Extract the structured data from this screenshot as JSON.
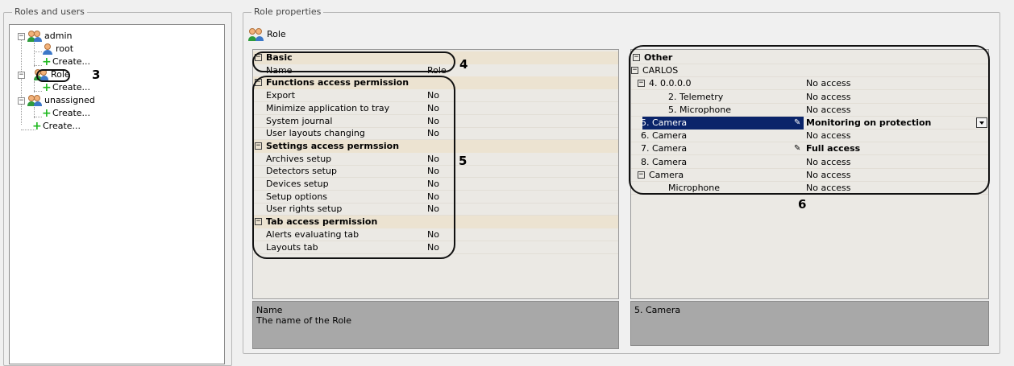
{
  "roles_panel": {
    "title": "Roles and users",
    "tree": [
      {
        "label": "admin"
      },
      {
        "label": "root"
      },
      {
        "label": "Create..."
      },
      {
        "label": "Role"
      },
      {
        "label": "Create..."
      },
      {
        "label": "unassigned"
      },
      {
        "label": "Create..."
      },
      {
        "label": "Create..."
      }
    ]
  },
  "props_panel": {
    "title": "Role properties",
    "header_label": "Role"
  },
  "left_grid": {
    "rows": [
      {
        "type": "cat",
        "name": "Basic"
      },
      {
        "type": "item",
        "name": "Name",
        "value": "Role"
      },
      {
        "type": "cat",
        "name": "Functions access permission"
      },
      {
        "type": "item",
        "name": "Export",
        "value": "No"
      },
      {
        "type": "item",
        "name": "Minimize application to tray",
        "value": "No"
      },
      {
        "type": "item",
        "name": "System journal",
        "value": "No"
      },
      {
        "type": "item",
        "name": "User layouts changing",
        "value": "No"
      },
      {
        "type": "cat",
        "name": "Settings access permssion"
      },
      {
        "type": "item",
        "name": "Archives setup",
        "value": "No"
      },
      {
        "type": "item",
        "name": "Detectors setup",
        "value": "No"
      },
      {
        "type": "item",
        "name": "Devices setup",
        "value": "No"
      },
      {
        "type": "item",
        "name": "Setup options",
        "value": "No"
      },
      {
        "type": "item",
        "name": "User rights setup",
        "value": "No"
      },
      {
        "type": "cat",
        "name": "Tab access permission"
      },
      {
        "type": "item",
        "name": "Alerts evaluating tab",
        "value": "No"
      },
      {
        "type": "item",
        "name": "Layouts tab",
        "value": "No"
      }
    ],
    "description_title": "Name",
    "description_text": "The name of the Role"
  },
  "right_grid": {
    "rows": [
      {
        "name": "Other",
        "value": ""
      },
      {
        "name": "CARLOS",
        "value": ""
      },
      {
        "name": "4. 0.0.0.0",
        "value": "No access"
      },
      {
        "name": "2. Telemetry",
        "value": "No access"
      },
      {
        "name": "5. Microphone",
        "value": "No access"
      },
      {
        "name": "5. Camera",
        "value": "Monitoring on protection"
      },
      {
        "name": "6. Camera",
        "value": "No access"
      },
      {
        "name": "7. Camera",
        "value": "Full access"
      },
      {
        "name": "8. Camera",
        "value": "No access"
      },
      {
        "name": "Camera",
        "value": "No access"
      },
      {
        "name": "Microphone",
        "value": "No access"
      }
    ],
    "description_title": "5. Camera"
  },
  "annotations": {
    "n3": "3",
    "n4": "4",
    "n5": "5",
    "n6": "6"
  },
  "icons": {
    "expand": "⊟",
    "collapse": "⊞",
    "pencil": "✎"
  }
}
